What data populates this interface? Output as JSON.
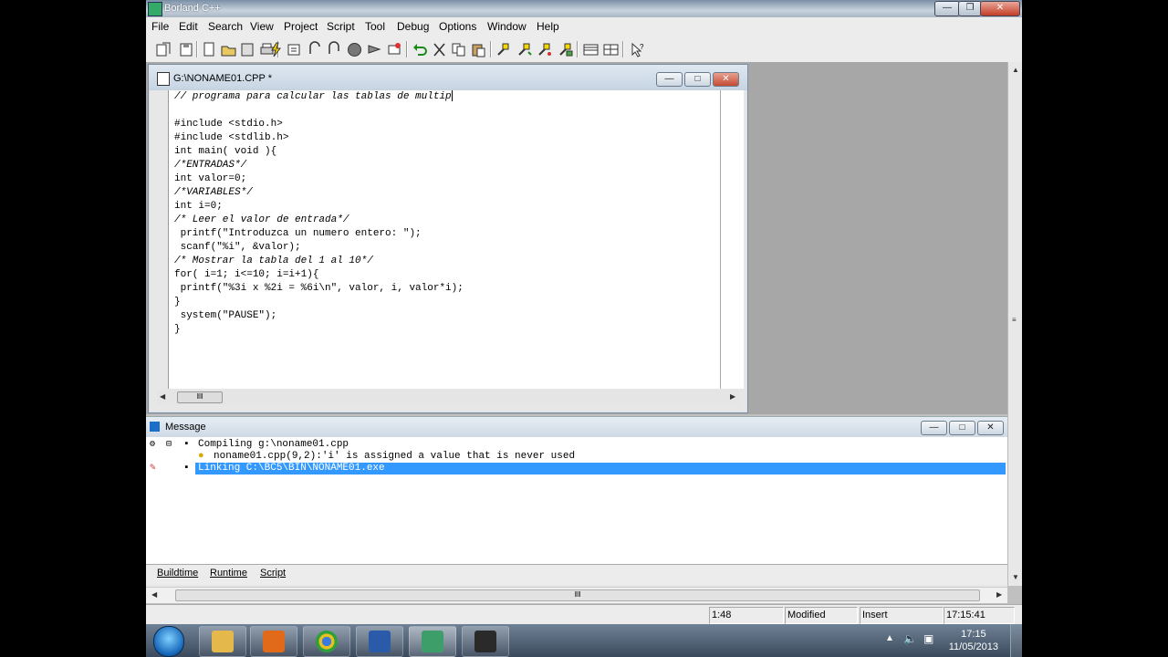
{
  "window": {
    "title": "Borland C++"
  },
  "menu": [
    "File",
    "Edit",
    "Search",
    "View",
    "Project",
    "Script",
    "Tool",
    "Debug",
    "Options",
    "Window",
    "Help"
  ],
  "editor": {
    "title": "G:\\NONAME01.CPP *",
    "lines": [
      "// programa para calcular las tablas de multip",
      "",
      "#include <stdio.h>",
      "#include <stdlib.h>",
      "int main( void ){",
      "/*ENTRADAS*/",
      "int valor=0;",
      "/*VARIABLES*/",
      "int i=0;",
      "/* Leer el valor de entrada*/",
      " printf(\"Introduzca un numero entero: \");",
      " scanf(\"%i\", &valor);",
      "/* Mostrar la tabla del 1 al 10*/",
      "for( i=1; i<=10; i=i+1){",
      " printf(\"%3i x %2i = %6i\\n\", valor, i, valor*i);",
      "}",
      " system(\"PAUSE\");",
      "}"
    ]
  },
  "message": {
    "title": "Message",
    "rows": [
      "Compiling g:\\noname01.cpp",
      "noname01.cpp(9,2):'i' is assigned a value that is never used",
      "Linking C:\\BC5\\BIN\\NONAME01.exe"
    ],
    "tabs": [
      "Buildtime",
      "Runtime",
      "Script"
    ]
  },
  "status": {
    "position": "1:48",
    "modified": "Modified",
    "mode": "Insert",
    "time": "17:15:41"
  },
  "taskbar": {
    "clock_time": "17:15",
    "clock_date": "11/05/2013"
  }
}
